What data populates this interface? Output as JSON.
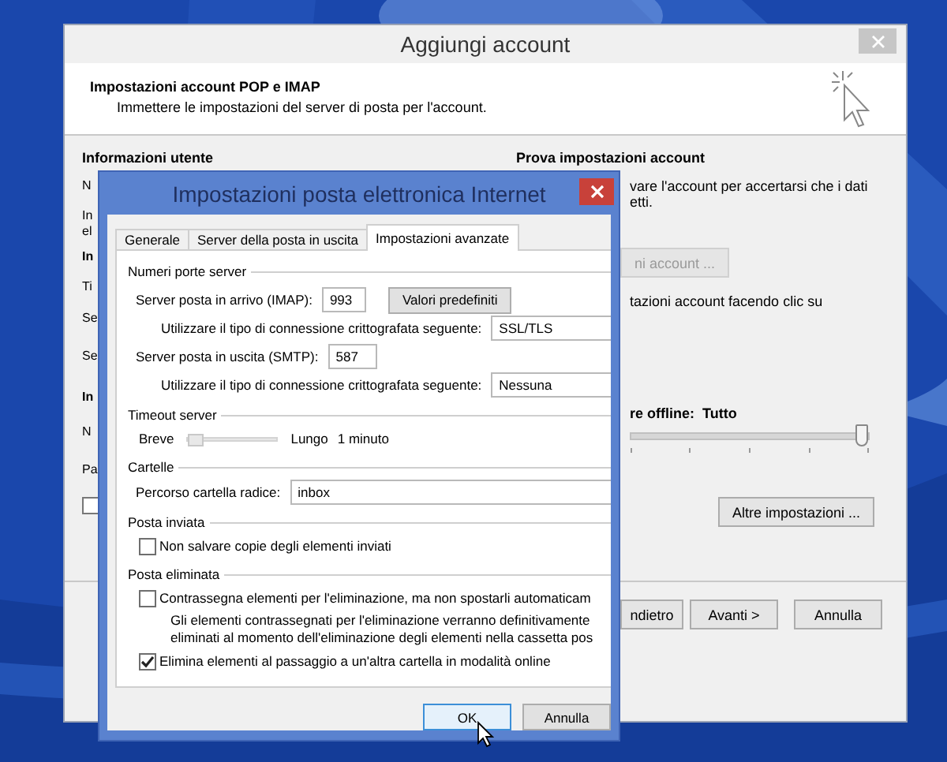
{
  "back_window": {
    "title": "Aggiungi account",
    "header_title": "Impostazioni account POP e IMAP",
    "header_subtitle": "Immettere le impostazioni del server di posta per l'account.",
    "left_heading": "Informazioni utente",
    "left_fragments": [
      {
        "text": "N",
        "kind": "label"
      },
      {
        "text": "In",
        "kind": "label"
      },
      {
        "text": "el",
        "kind": "label"
      },
      {
        "text": "In",
        "kind": "heading"
      },
      {
        "text": "Ti",
        "kind": "label"
      },
      {
        "text": "Se",
        "kind": "label"
      },
      {
        "text": "Se",
        "kind": "label"
      },
      {
        "text": "In",
        "kind": "heading"
      },
      {
        "text": "N",
        "kind": "label"
      },
      {
        "text": "Pa",
        "kind": "label"
      }
    ],
    "left_checkbox": {
      "checked": false
    },
    "right_heading": "Prova impostazioni account",
    "right_lines": [
      "vare l'account per accertarsi che i dati",
      "etti."
    ],
    "test_button": {
      "label": "ni account ...",
      "disabled": true
    },
    "right_note": "tazioni account facendo clic su",
    "offline": {
      "label": "re offline:",
      "value": "Tutto",
      "level": 1
    },
    "more_button": "Altre impostazioni ...",
    "footer_buttons": [
      "ndietro",
      "Avanti >",
      "Annulla"
    ]
  },
  "dialog": {
    "title": "Impostazioni posta elettronica Internet",
    "tabs": [
      {
        "label": "Generale",
        "selected": false
      },
      {
        "label": "Server della posta in uscita",
        "selected": false
      },
      {
        "label": "Impostazioni avanzate",
        "selected": true
      }
    ],
    "ports": {
      "heading": "Numeri porte server",
      "incoming_label": "Server posta in arrivo (IMAP):",
      "incoming_value": "993",
      "defaults_button": "Valori predefiniti",
      "incoming_enc_label": "Utilizzare il tipo di connessione crittografata seguente:",
      "incoming_enc_value": "SSL/TLS",
      "outgoing_label": "Server posta in uscita (SMTP):",
      "outgoing_value": "587",
      "outgoing_enc_label": "Utilizzare il tipo di connessione crittografata seguente:",
      "outgoing_enc_value": "Nessuna"
    },
    "timeout": {
      "heading": "Timeout server",
      "short_label": "Breve",
      "long_label": "Lungo",
      "value": "1 minuto",
      "level": 0
    },
    "folders": {
      "heading": "Cartelle",
      "root_label": "Percorso cartella radice:",
      "root_value": "inbox"
    },
    "sent": {
      "heading": "Posta inviata",
      "options": [
        {
          "label": "Non salvare copie degli elementi inviati",
          "checked": false
        }
      ]
    },
    "deleted": {
      "heading": "Posta eliminata",
      "mark_option": {
        "label": "Contrassegna elementi per l'eliminazione, ma non spostarli automaticam",
        "checked": false
      },
      "note": [
        "Gli elementi contrassegnati per l'eliminazione verranno definitivamente",
        "eliminati al momento dell'eliminazione degli elementi nella cassetta pos"
      ],
      "purge_option": {
        "label": "Elimina elementi al passaggio a un'altra cartella in modalità online",
        "checked": true
      }
    },
    "buttons": [
      {
        "label": "OK",
        "focused": true
      },
      {
        "label": "Annulla",
        "focused": false
      }
    ]
  }
}
